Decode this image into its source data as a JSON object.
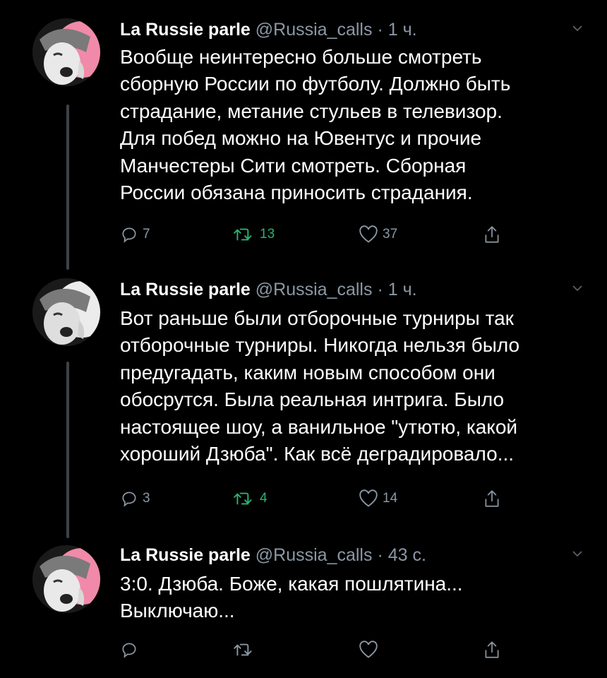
{
  "tweets": [
    {
      "name": "La Russie parle",
      "handle": "@Russia_calls",
      "separator": "·",
      "time": "1 ч.",
      "lines": [
        "Вообще неинтересно больше смотреть",
        "сборную России по футболу. Должно быть",
        "страдание, метание стульев в телевизор.",
        "Для побед можно на Ювентус и прочие",
        "Манчестеры Сити смотреть. Сборная",
        "России обязана приносить страдания."
      ],
      "replies": "7",
      "retweets": "13",
      "likes": "37"
    },
    {
      "name": "La Russie parle",
      "handle": "@Russia_calls",
      "separator": "·",
      "time": "1 ч.",
      "lines": [
        "Вот раньше были отборочные турниры так",
        "отборочные турниры. Никогда нельзя было",
        "предугадать, каким новым способом они",
        "обосрутся. Была реальная интрига. Было",
        "настоящее шоу, а ванильное \"утютю, какой",
        "хороший Дзюба\". Как всё деградировало..."
      ],
      "replies": "3",
      "retweets": "4",
      "likes": "14"
    },
    {
      "name": "La Russie parle",
      "handle": "@Russia_calls",
      "separator": "·",
      "time": "43 с.",
      "lines": [
        "3:0. Дзюба. Боже, какая пошлятина...",
        "Выключаю..."
      ],
      "replies": "",
      "retweets": "",
      "likes": ""
    }
  ],
  "colors": {
    "background": "#000000",
    "text": "#ffffff",
    "muted": "#8b98a5",
    "retweet_green": "#2ab36f",
    "thread_line": "#3d4248",
    "avatar_accent": "#f08aa8"
  },
  "icons": [
    "reply-icon",
    "retweet-icon",
    "like-icon",
    "share-icon",
    "chevron-down-icon"
  ]
}
